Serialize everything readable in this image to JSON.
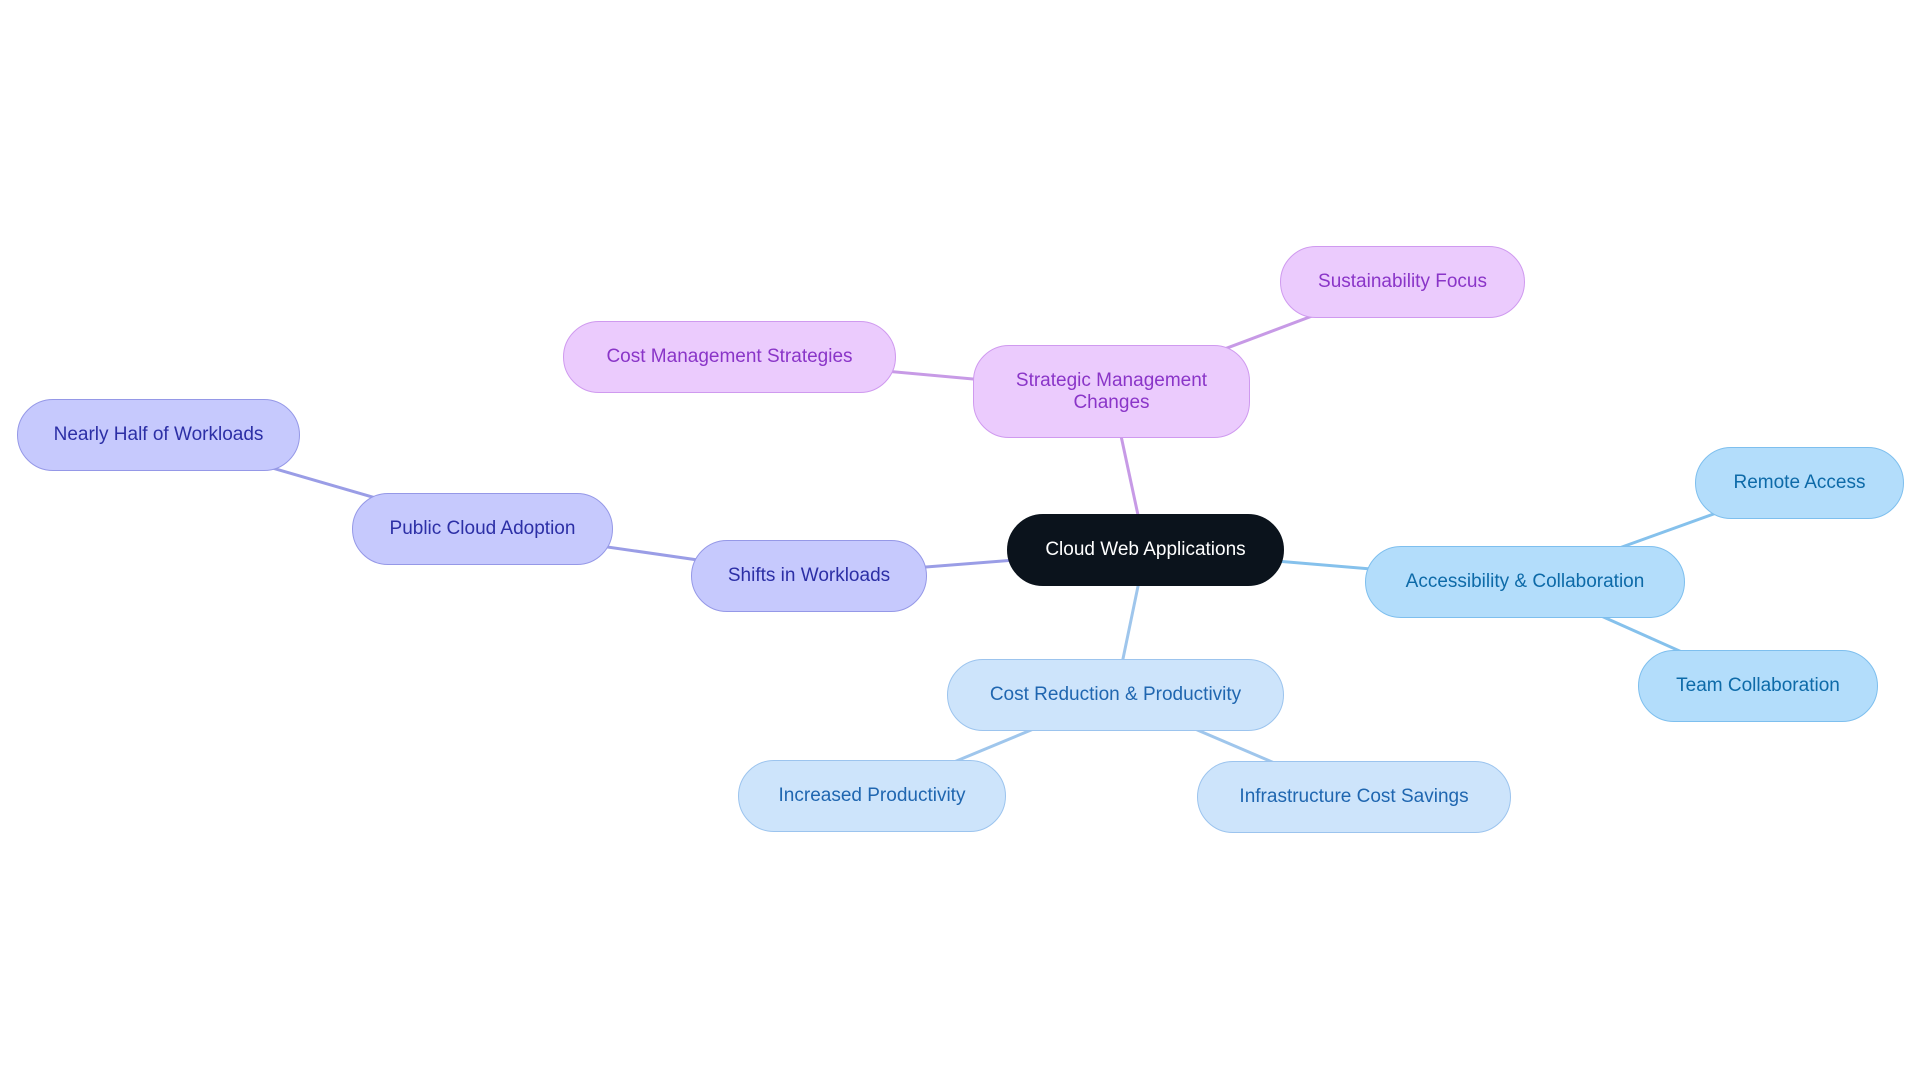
{
  "diagram": {
    "type": "mindmap",
    "colors": {
      "root": "#0b131c",
      "purple_branch": "#ebcbfd",
      "indigo_branch": "#c6c9fd",
      "sky_branch": "#b3ddfb",
      "blue_branch": "#cde4fb",
      "purple_edge": "#c79ae6",
      "indigo_edge": "#9a9de6",
      "sky_edge": "#85c1ec",
      "blue_edge": "#9fc6ec"
    },
    "root": {
      "id": "root",
      "label": "Cloud Web Applications"
    },
    "nodes": [
      {
        "id": "strategic",
        "parent": "root",
        "label": "Strategic Management\nChanges",
        "branch": "purple"
      },
      {
        "id": "sustain",
        "parent": "strategic",
        "label": "Sustainability Focus",
        "branch": "purple"
      },
      {
        "id": "costmgmt",
        "parent": "strategic",
        "label": "Cost Management Strategies",
        "branch": "purple"
      },
      {
        "id": "shifts",
        "parent": "root",
        "label": "Shifts in Workloads",
        "branch": "indigo"
      },
      {
        "id": "public",
        "parent": "shifts",
        "label": "Public Cloud Adoption",
        "branch": "indigo"
      },
      {
        "id": "half",
        "parent": "public",
        "label": "Nearly Half of Workloads",
        "branch": "indigo"
      },
      {
        "id": "access",
        "parent": "root",
        "label": "Accessibility & Collaboration",
        "branch": "sky"
      },
      {
        "id": "remote",
        "parent": "access",
        "label": "Remote Access",
        "branch": "sky"
      },
      {
        "id": "team",
        "parent": "access",
        "label": "Team Collaboration",
        "branch": "sky"
      },
      {
        "id": "costred",
        "parent": "root",
        "label": "Cost Reduction & Productivity",
        "branch": "blue"
      },
      {
        "id": "prod",
        "parent": "costred",
        "label": "Increased Productivity",
        "branch": "blue"
      },
      {
        "id": "infra",
        "parent": "costred",
        "label": "Infrastructure Cost Savings",
        "branch": "blue"
      }
    ]
  }
}
